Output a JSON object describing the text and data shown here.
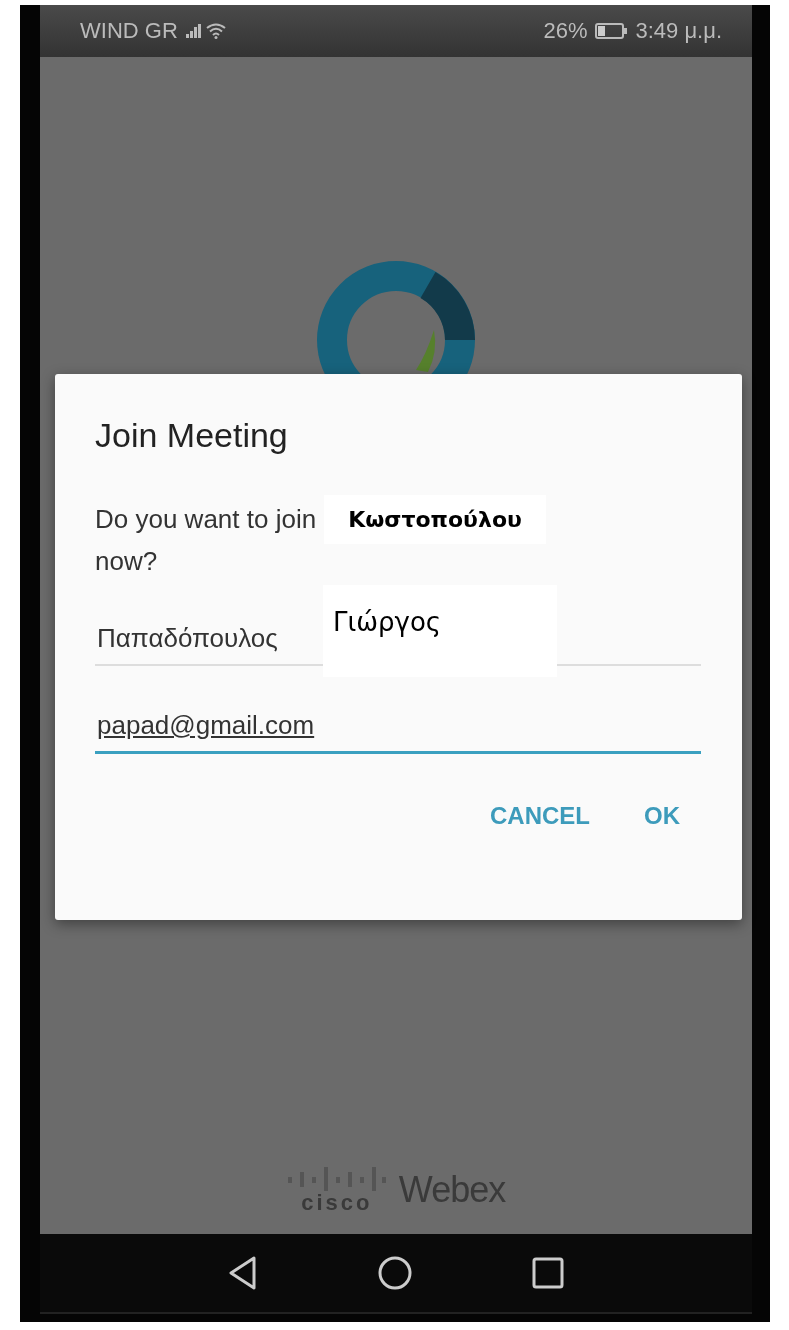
{
  "status_bar": {
    "carrier": "WIND GR",
    "battery_percent": "26%",
    "time": "3:49 μ.μ."
  },
  "dialog": {
    "title": "Join Meeting",
    "message_start": "Do you want to join",
    "meeting_host": "Κωστοπούλου",
    "message_end": "now?",
    "fields": [
      {
        "kind": "name",
        "value": "Παπαδόπουλος",
        "overlay": "Γιώργος",
        "focused": false
      },
      {
        "kind": "email",
        "value": "papad@gmail.com",
        "focused": true
      }
    ],
    "buttons": [
      "CANCEL",
      "OK"
    ]
  },
  "brand": {
    "company": "cisco",
    "product": "Webex"
  }
}
